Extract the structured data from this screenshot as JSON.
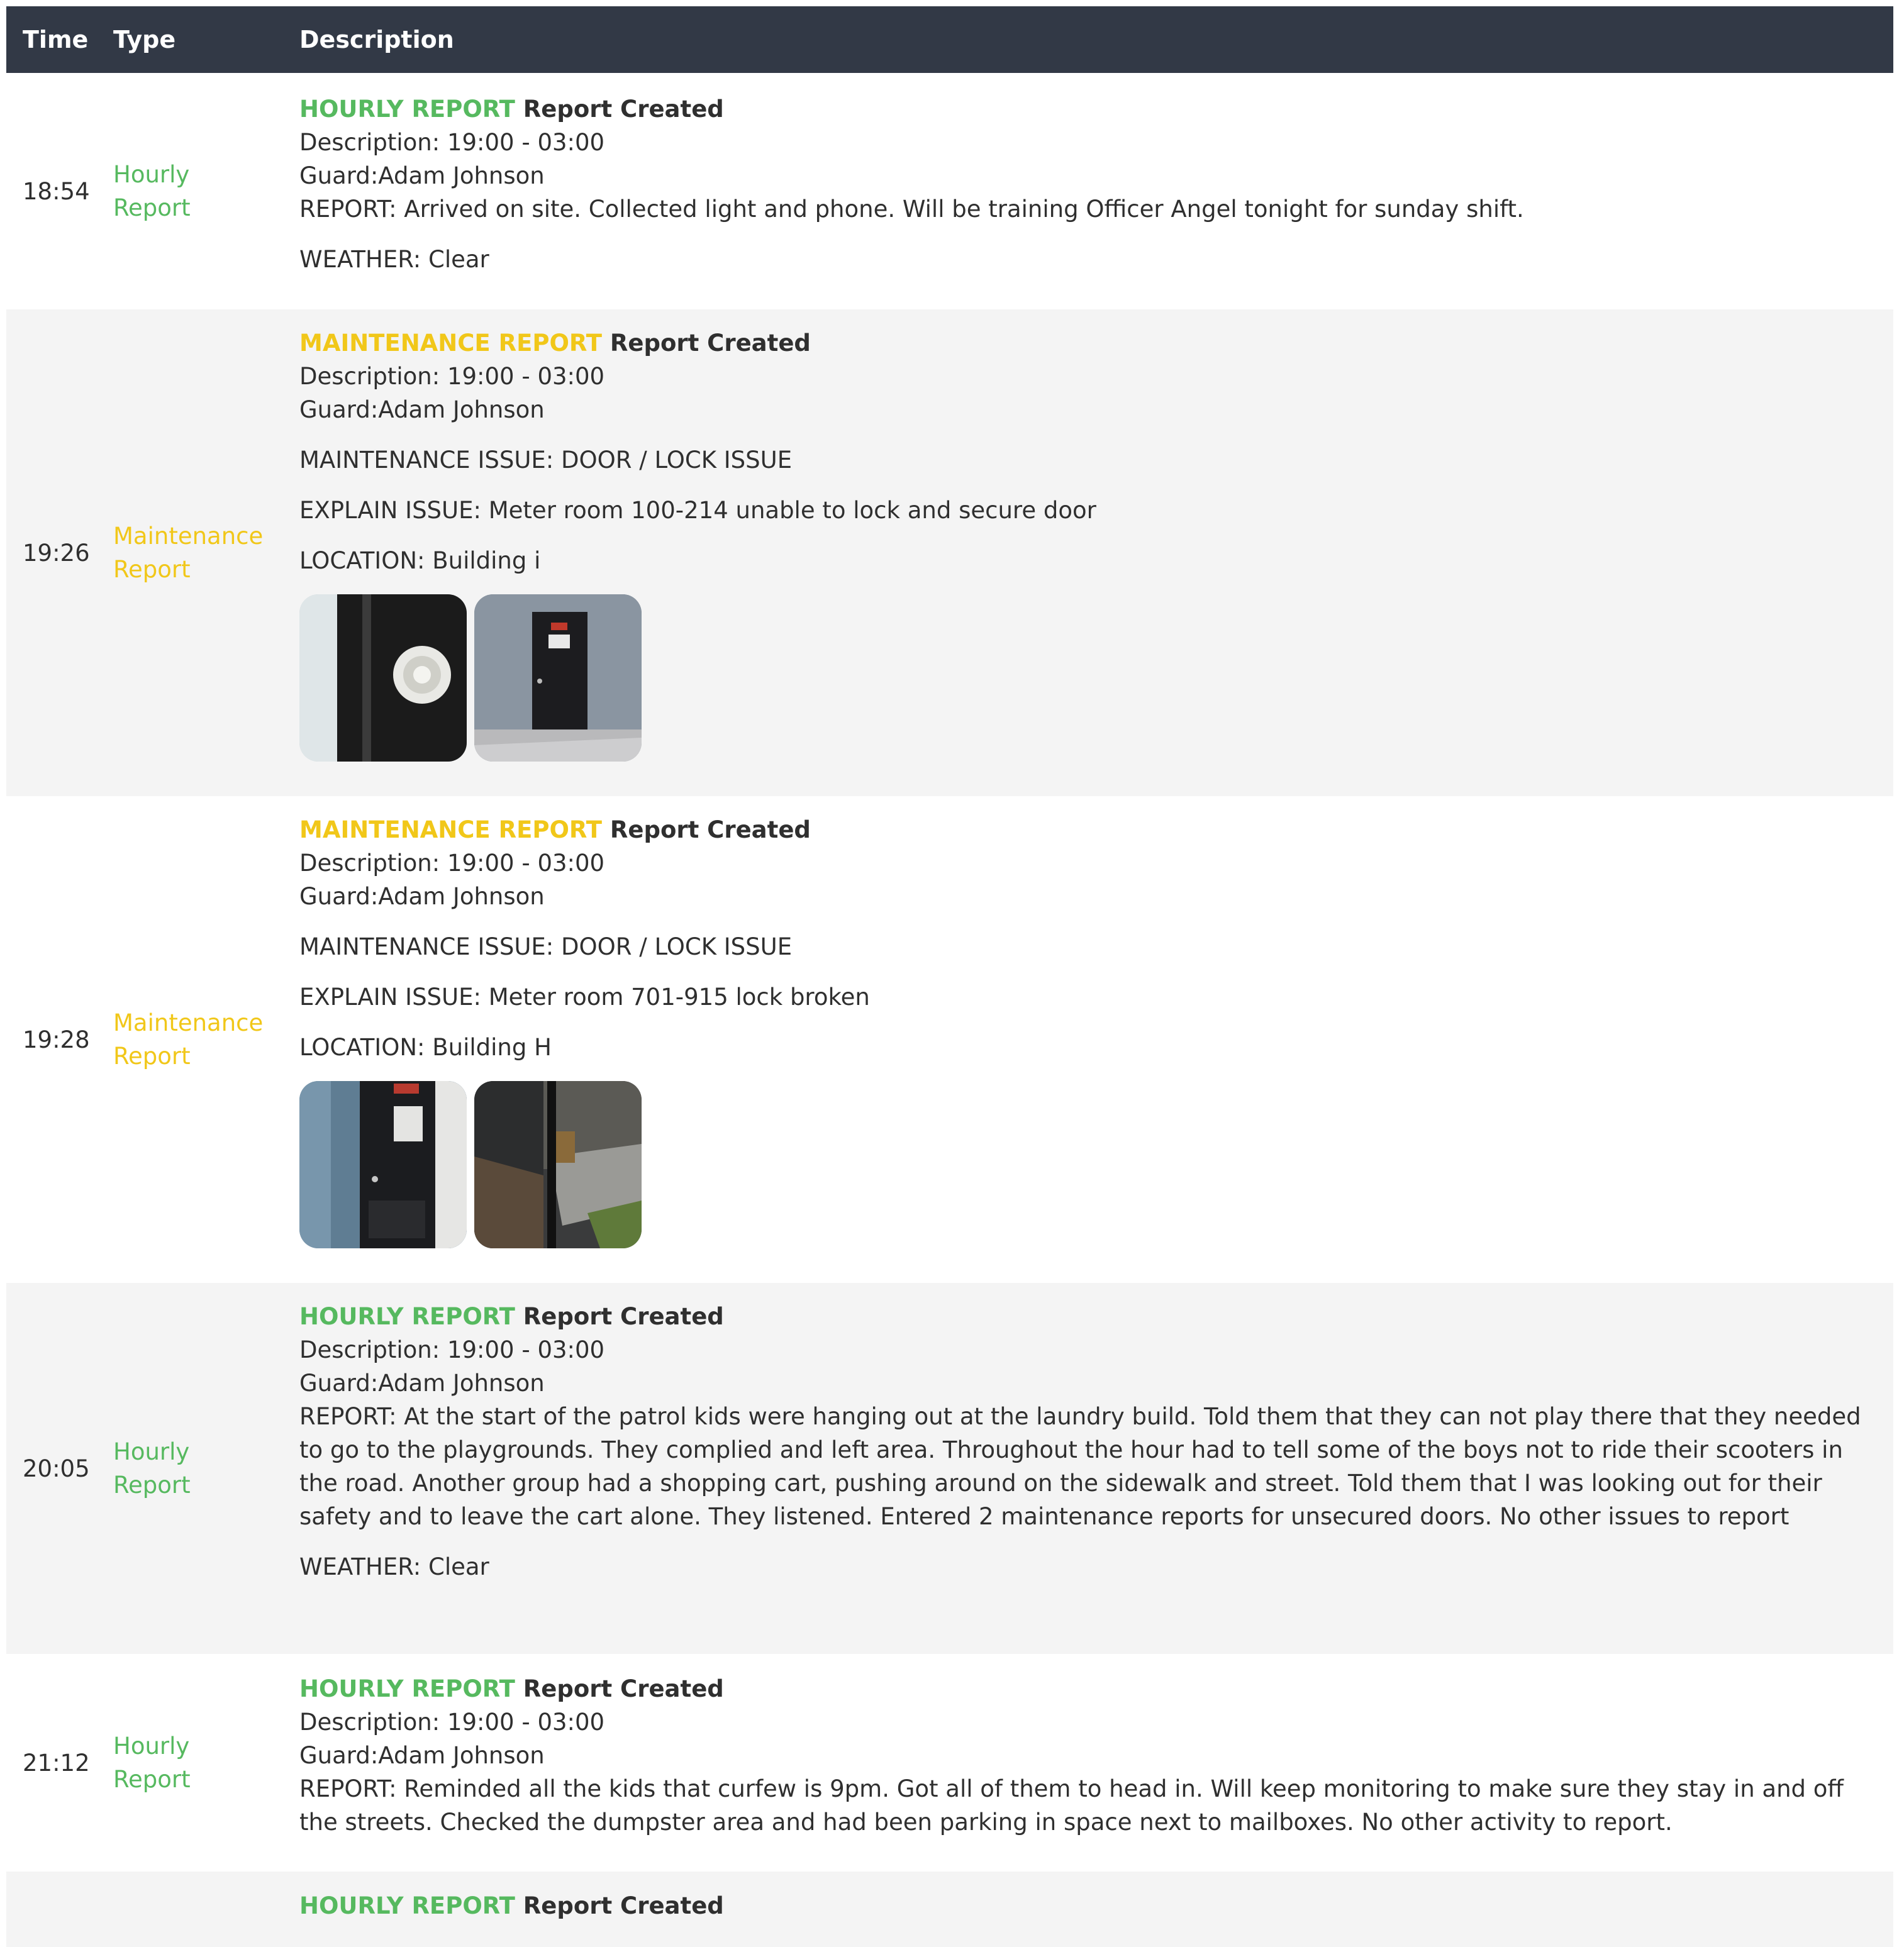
{
  "header": {
    "time": "Time",
    "type": "Type",
    "description": "Description"
  },
  "rows": [
    {
      "time": "18:54",
      "type_line1": "Hourly",
      "type_line2": "Report",
      "title_tag": "HOURLY REPORT",
      "title_rest": "Report Created",
      "description": "Description: 19:00 - 03:00",
      "guard": "Guard:Adam Johnson",
      "report": "REPORT: Arrived on site. Collected light and phone. Will be training Officer Angel tonight for sunday shift.",
      "weather": "WEATHER: Clear"
    },
    {
      "time": "19:26",
      "type_line1": "Maintenance",
      "type_line2": "Report",
      "title_tag": "MAINTENANCE REPORT",
      "title_rest": "Report Created",
      "description": "Description: 19:00 - 03:00",
      "guard": "Guard:Adam Johnson",
      "issue": "MAINTENANCE ISSUE: DOOR / LOCK ISSUE",
      "explain": "EXPLAIN ISSUE: Meter room 100-214 unable to lock and secure door",
      "location": "LOCATION: Building i"
    },
    {
      "time": "19:28",
      "type_line1": "Maintenance",
      "type_line2": "Report",
      "title_tag": "MAINTENANCE REPORT",
      "title_rest": "Report Created",
      "description": "Description: 19:00 - 03:00",
      "guard": "Guard:Adam Johnson",
      "issue": "MAINTENANCE ISSUE: DOOR / LOCK ISSUE",
      "explain": "EXPLAIN ISSUE: Meter room 701-915 lock broken",
      "location": "LOCATION: Building H"
    },
    {
      "time": "20:05",
      "type_line1": "Hourly",
      "type_line2": "Report",
      "title_tag": "HOURLY REPORT",
      "title_rest": "Report Created",
      "description": "Description: 19:00 - 03:00",
      "guard": "Guard:Adam Johnson",
      "report": "REPORT: At the start of the patrol kids were hanging out at the laundry build. Told them that they can not play there that they needed to go to the playgrounds. They complied and left area. Throughout the hour had to tell some of the boys not to ride their scooters in the road. Another group had a shopping cart, pushing around on the sidewalk and street. Told them that I was looking out for their safety and to leave the cart alone. They listened. Entered 2 maintenance reports for unsecured doors. No other issues to report",
      "weather": "WEATHER: Clear"
    },
    {
      "time": "21:12",
      "type_line1": "Hourly",
      "type_line2": "Report",
      "title_tag": "HOURLY REPORT",
      "title_rest": "Report Created",
      "description": "Description: 19:00 - 03:00",
      "guard": "Guard:Adam Johnson",
      "report": "REPORT: Reminded all the kids that curfew is 9pm. Got all of them to head in. Will keep monitoring to make sure they stay in and off the streets. Checked the dumpster area and had been parking in space next to mailboxes. No other activity to report."
    },
    {
      "title_tag": "HOURLY REPORT",
      "title_rest": "Report Created"
    }
  ],
  "colors": {
    "header_bg": "#323946",
    "hourly": "#56b95f",
    "maintenance": "#f1c719",
    "alt_row": "#f4f4f4"
  }
}
